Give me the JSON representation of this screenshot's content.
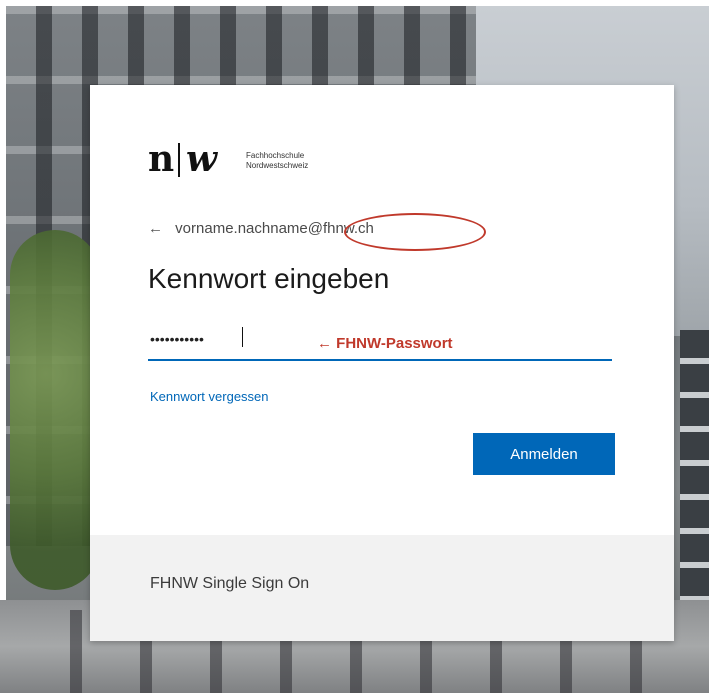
{
  "logo": {
    "mark_n": "n",
    "mark_w": "w",
    "line1": "Fachhochschule",
    "line2": "Nordwestschweiz"
  },
  "identity": {
    "back_icon": "arrow-left-icon",
    "email": "vorname.nachname@fhnw.ch"
  },
  "heading": "Kennwort eingeben",
  "password": {
    "value": "•••••••••••",
    "annotation": "← FHNW-Passwort"
  },
  "forgot_link": "Kennwort vergessen",
  "signin_button": "Anmelden",
  "footer": "FHNW Single Sign On",
  "colors": {
    "accent": "#0067b8",
    "annotation": "#c0392b",
    "footer_bg": "#f2f2f2"
  }
}
